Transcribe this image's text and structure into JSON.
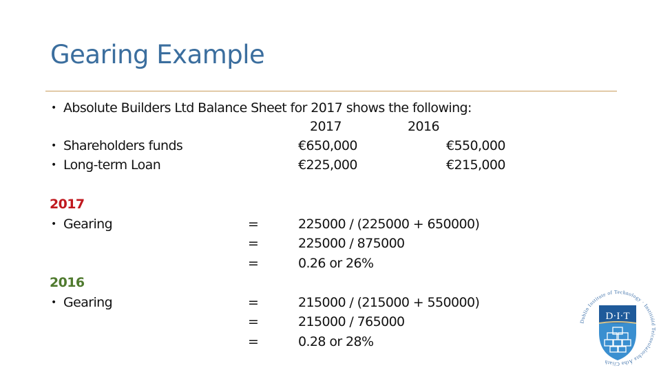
{
  "slide": {
    "title": "Gearing Example",
    "intro": "Absolute Builders Ltd Balance Sheet for 2017 shows the following:",
    "table": {
      "col_headers": [
        "2017",
        "2016"
      ],
      "rows": [
        {
          "label": "Shareholders funds",
          "v2017": "€650,000",
          "v2016": "€550,000"
        },
        {
          "label": "Long-term Loan",
          "v2017": "€225,000",
          "v2016": "€215,000"
        }
      ]
    },
    "sections": [
      {
        "year": "2017",
        "year_color": "#c0191f",
        "label": "Gearing",
        "eq": "=",
        "steps": [
          "225000 / (225000 + 650000)",
          "225000 / 875000",
          "0.26 or 26%"
        ]
      },
      {
        "year": "2016",
        "year_color": "#4f7a2e",
        "label": "Gearing",
        "eq": "=",
        "steps": [
          "215000 / (215000 + 550000)",
          "215000 / 765000",
          "0.28 or 28%"
        ]
      }
    ],
    "logo": {
      "text": "D·I·T",
      "ring_text": "Dublin Institute of Technology · Institiúid Teicneolaíochta Átha Cliath"
    },
    "colors": {
      "title": "#3b6e9e",
      "rule": "#c89a5a",
      "logo_blue": "#1f5a9a",
      "logo_light": "#3a8fd0"
    }
  }
}
